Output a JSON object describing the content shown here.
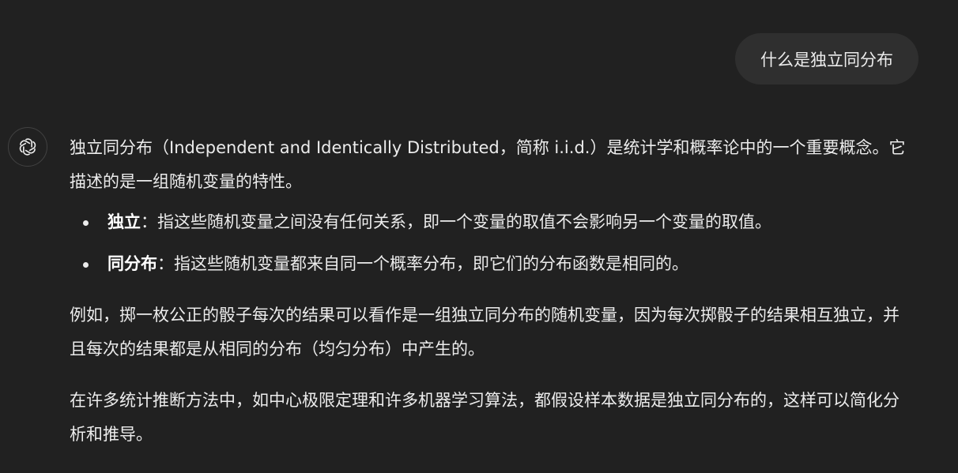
{
  "user_message": "什么是独立同分布",
  "assistant": {
    "avatar_icon": "openai-logo-icon",
    "intro": "独立同分布（Independent and Identically Distributed，简称 i.i.d.）是统计学和概率论中的一个重要概念。它描述的是一组随机变量的特性。",
    "bullets": [
      {
        "term": "独立",
        "text": "：指这些随机变量之间没有任何关系，即一个变量的取值不会影响另一个变量的取值。"
      },
      {
        "term": "同分布",
        "text": "：指这些随机变量都来自同一个概率分布，即它们的分布函数是相同的。"
      }
    ],
    "example": "例如，掷一枚公正的骰子每次的结果可以看作是一组独立同分布的随机变量，因为每次掷骰子的结果相互独立，并且每次的结果都是从相同的分布（均匀分布）中产生的。",
    "conclusion": "在许多统计推断方法中，如中心极限定理和许多机器学习算法，都假设样本数据是独立同分布的，这样可以简化分析和推导。"
  },
  "colors": {
    "background": "#212121",
    "user_bubble": "#2f2f2f",
    "text": "#ececec"
  }
}
